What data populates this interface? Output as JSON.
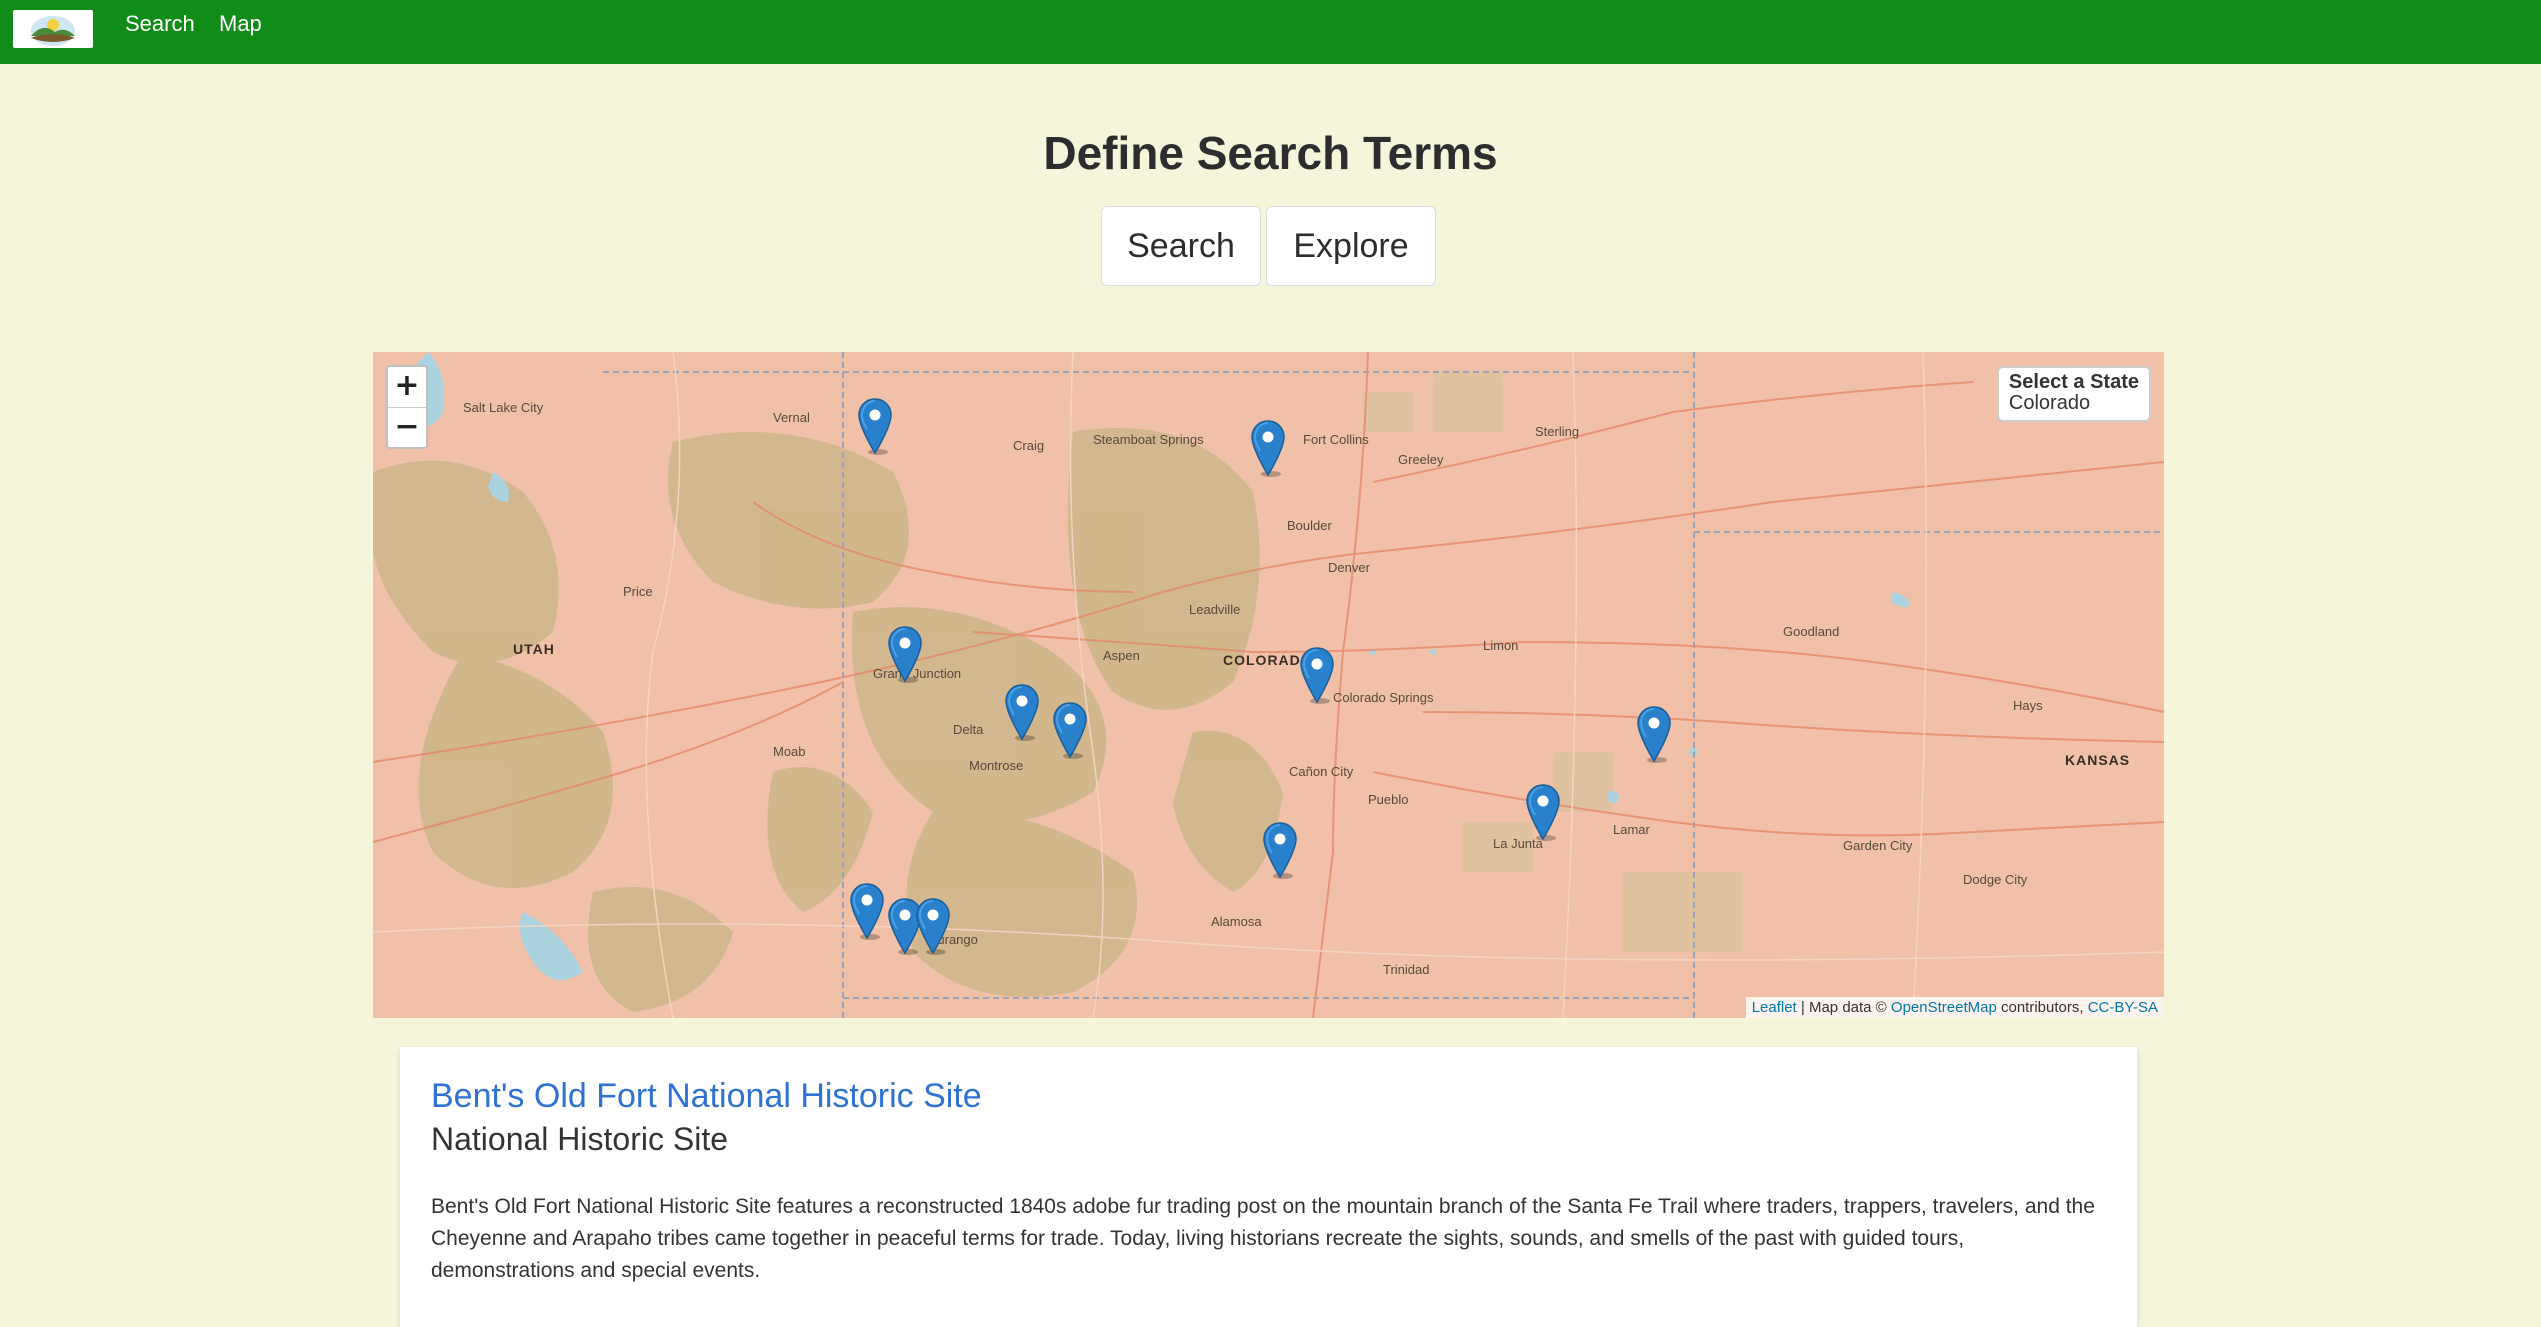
{
  "navbar": {
    "logo": "landscape-logo",
    "links": [
      "Search",
      "Map"
    ]
  },
  "header": {
    "title": "Define Search Terms",
    "buttons": [
      "Search",
      "Explore"
    ]
  },
  "map": {
    "zoom_in": "+",
    "zoom_out": "−",
    "state_select": {
      "label": "Select a State",
      "value": "Colorado"
    },
    "attribution": {
      "leaflet": "Leaflet",
      "sep1": " | Map data © ",
      "osm": "OpenStreetMap",
      "sep2": " contributors, ",
      "license": "CC-BY-SA"
    },
    "labels": {
      "colorado": "COLORADO",
      "utah": "UTAH",
      "kansas": "KANSAS",
      "denver": "Denver",
      "boulder": "Boulder",
      "fort_collins": "Fort Collins",
      "colorado_springs": "Colorado Springs",
      "pueblo": "Pueblo",
      "grand_junction": "Grand Junction",
      "aspen": "Aspen",
      "steamboat": "Steamboat Springs",
      "la_junta": "La Junta",
      "salt_lake": "Salt Lake City",
      "moab": "Moab",
      "lamar": "Lamar",
      "sterling": "Sterling",
      "dodge_city": "Dodge City",
      "garden_city": "Garden City",
      "montrose": "Montrose",
      "durango": "Durango",
      "alamosa": "Alamosa",
      "trinidad": "Trinidad",
      "limon": "Limon",
      "greeley": "Greeley",
      "vernal": "Vernal",
      "price": "Price",
      "goodland": "Goodland",
      "hays": "Hays",
      "leadville": "Leadville",
      "canon_city": "Cañon City",
      "craig": "Craig",
      "delta": "Delta"
    },
    "markers": 13
  },
  "result": {
    "title": "Bent's Old Fort National Historic Site",
    "designation": "National Historic Site",
    "description": "Bent's Old Fort National Historic Site features a reconstructed 1840s adobe fur trading post on the mountain branch of the Santa Fe Trail where traders, trappers, travelers, and the Cheyenne and Arapaho tribes came together in peaceful terms for trade. Today, living historians recreate the sights, sounds, and smells of the past with guided tours, demonstrations and special events."
  }
}
